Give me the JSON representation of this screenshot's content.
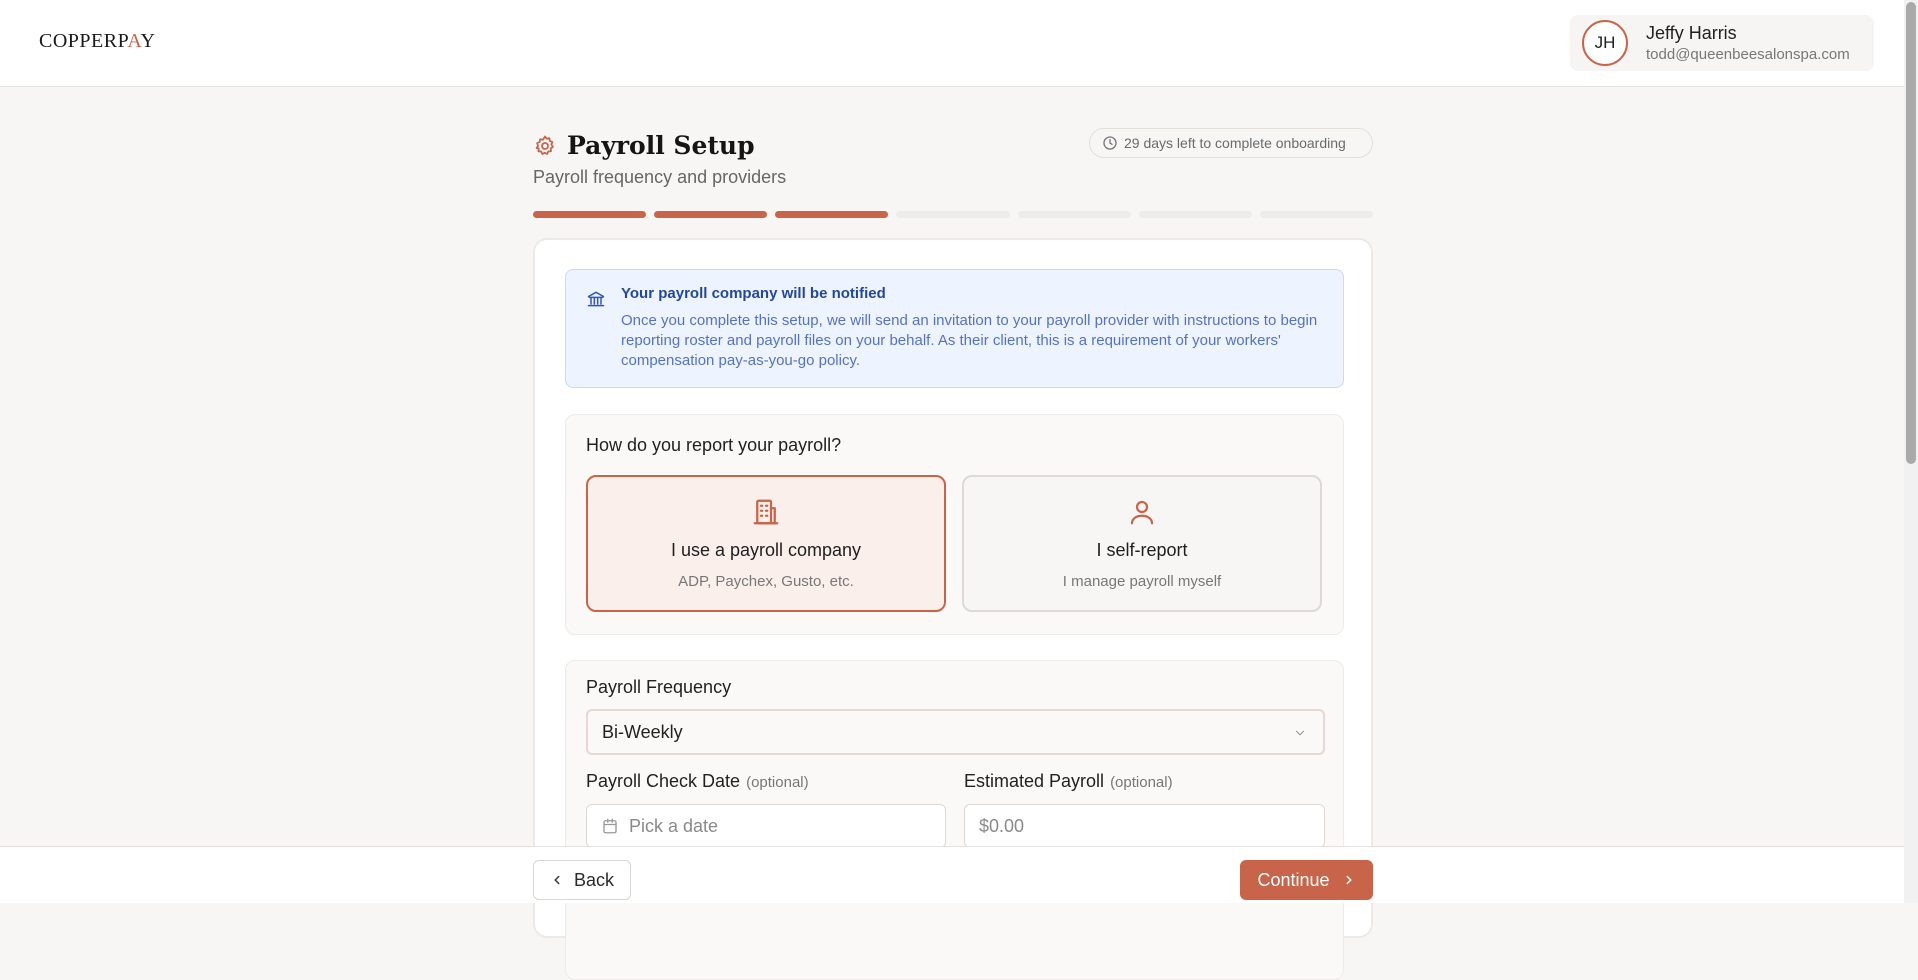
{
  "brand": {
    "logo_main": "COPPERP",
    "logo_accent": "A",
    "logo_end": "Y",
    "accent_color": "#c8644a"
  },
  "user": {
    "initials": "JH",
    "name": "Jeffy Harris",
    "email": "todd@queenbeesalonspa.com"
  },
  "header": {
    "title": "Payroll Setup",
    "subtitle": "Payroll frequency and providers",
    "deadline": "29 days left to complete onboarding",
    "icon": "gear-icon"
  },
  "progress": {
    "total_steps": 7,
    "completed_steps": 3
  },
  "notice": {
    "icon": "bank-icon",
    "title": "Your payroll company will be notified",
    "body": "Once you complete this setup, we will send an invitation to your payroll provider with instructions to begin reporting roster and payroll files on your behalf. As their client, this is a requirement of your workers' compensation pay-as-you-go policy."
  },
  "report": {
    "question": "How do you report your payroll?",
    "options": [
      {
        "icon": "building-icon",
        "title": "I use a payroll company",
        "desc": "ADP, Paychex, Gusto, etc.",
        "selected": true
      },
      {
        "icon": "person-icon",
        "title": "I self-report",
        "desc": "I manage payroll myself",
        "selected": false
      }
    ]
  },
  "frequency": {
    "label": "Payroll Frequency",
    "value": "Bi-Weekly"
  },
  "check_date": {
    "label": "Payroll Check Date",
    "optional": "(optional)",
    "placeholder": "Pick a date"
  },
  "estimated": {
    "label": "Estimated Payroll",
    "optional": "(optional)",
    "placeholder": "$0.00"
  },
  "footer": {
    "back": "Back",
    "continue": "Continue"
  }
}
